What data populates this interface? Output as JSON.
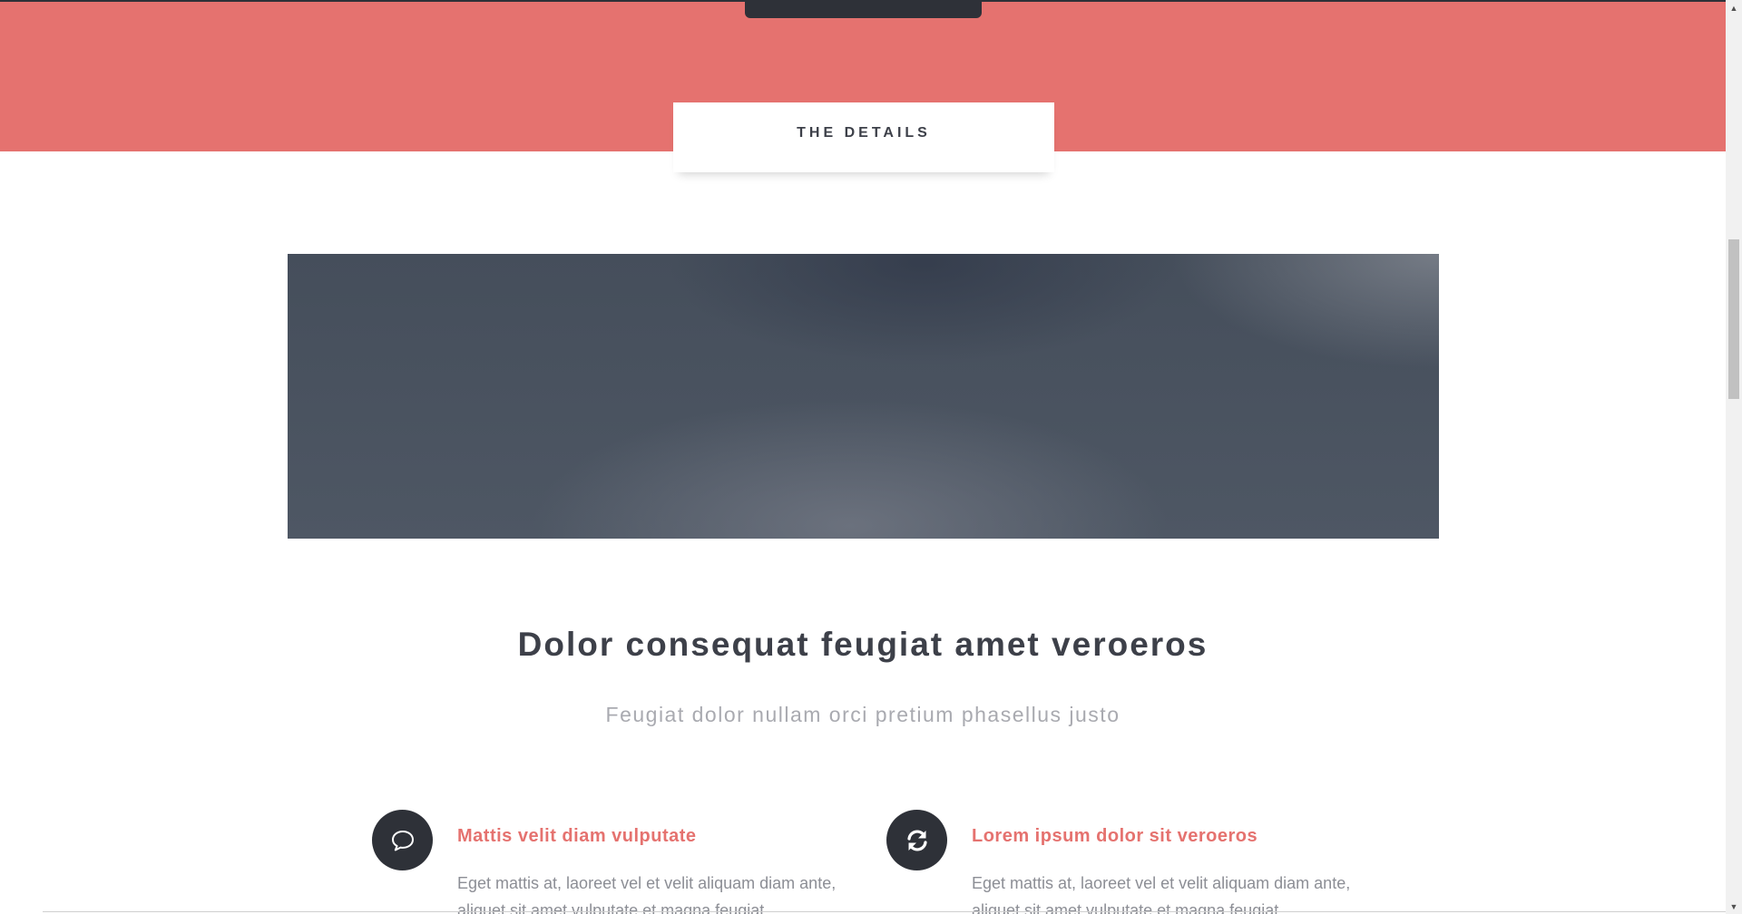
{
  "banner": {
    "accent_color": "#e5726f",
    "details_title": "THE DETAILS"
  },
  "main": {
    "heading": "Dolor consequat feugiat amet veroeros",
    "subheading": "Feugiat dolor nullam orci pretium phasellus justo"
  },
  "features": [
    {
      "icon": "speech-bubble-icon",
      "title": "Mattis velit diam vulputate",
      "text": "Eget mattis at, laoreet vel et velit aliquam diam ante, aliquet sit amet vulputate et magna feugiat"
    },
    {
      "icon": "refresh-icon",
      "title": "Lorem ipsum dolor sit veroeros",
      "text": "Eget mattis at, laoreet vel et velit aliquam diam ante, aliquet sit amet vulputate et magna feugiat"
    }
  ],
  "colors": {
    "dark": "#2e3138",
    "heading": "#3d4049",
    "muted": "#a9aab0",
    "body_text": "#8c8e95"
  }
}
